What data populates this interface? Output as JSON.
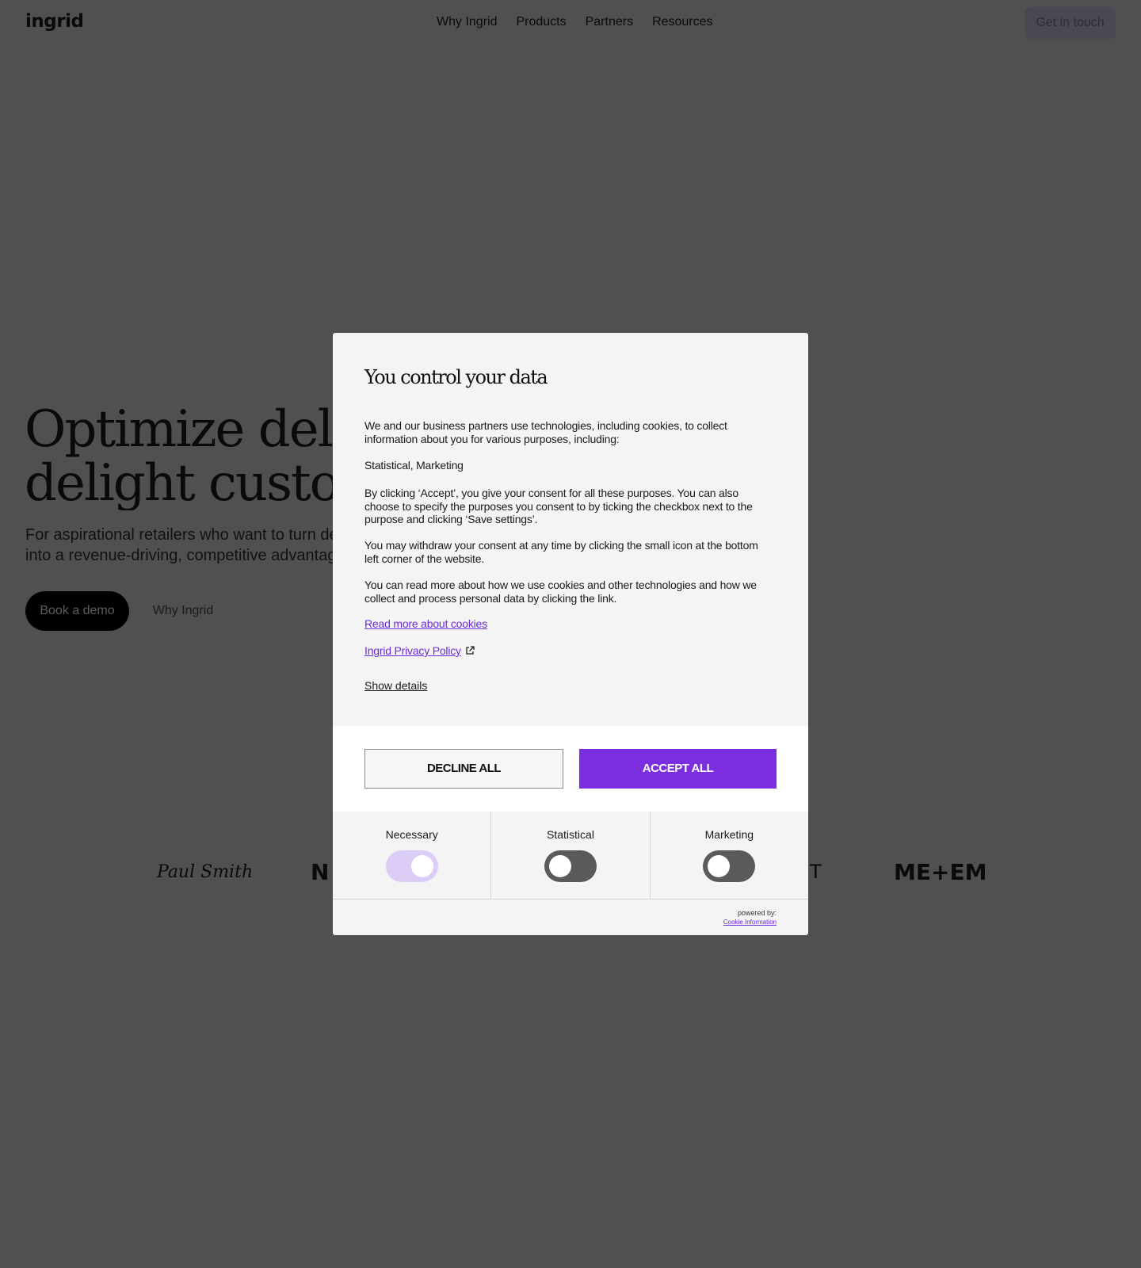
{
  "nav": {
    "logo": "ingrid",
    "links": [
      "Why Ingrid",
      "Products",
      "Partners",
      "Resources"
    ],
    "cta": "Get in touch"
  },
  "hero": {
    "title_line1": "Optimize deliv",
    "title_line2": "delight custon",
    "subtitle_line1": "For aspirational retailers who want to turn de",
    "subtitle_line2": "into a revenue-driving, competitive advantag",
    "primary_button": "Book a demo",
    "secondary_button": "Why Ingrid"
  },
  "brand_logos": [
    "Paul Smith",
    "N",
    "NT",
    "ME+EM"
  ],
  "consent": {
    "title": "You control your data",
    "p1": "We and our business partners use technologies, including cookies, to collect information about you for various purposes, including:",
    "p2": "Statistical, Marketing",
    "p3": "By clicking ‘Accept’, you give your consent for all these purposes. You can also choose to specify the purposes you consent to by ticking the checkbox next to the purpose and clicking ‘Save settings’.",
    "p4": "You may withdraw your consent at any time by clicking the small icon at the bottom left corner of the website.",
    "p5": "You can read more about how we use cookies and other technologies and how we collect and process personal data by clicking the link.",
    "link_cookies": "Read more about cookies",
    "link_privacy": "Ingrid Privacy Policy",
    "show_details": "Show details",
    "decline": "DECLINE ALL",
    "accept": "ACCEPT ALL",
    "toggles": [
      {
        "label": "Necessary",
        "on": true
      },
      {
        "label": "Statistical",
        "on": false
      },
      {
        "label": "Marketing",
        "on": false
      }
    ],
    "powered_by": "powered by:",
    "powered_link": "Cookie Information",
    "accent_color": "#7a2ee0"
  }
}
